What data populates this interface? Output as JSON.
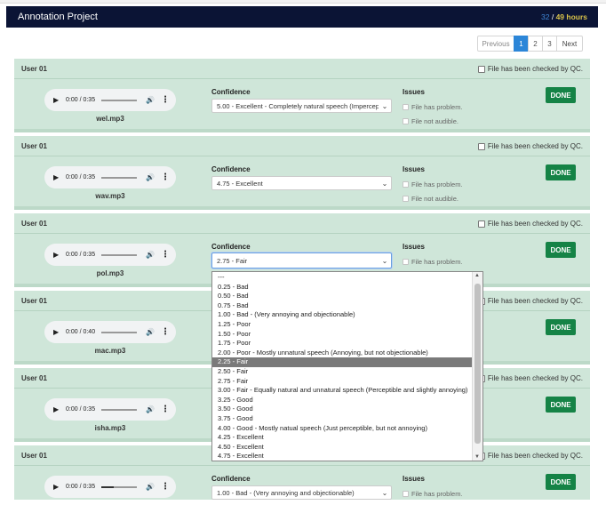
{
  "navbar": {
    "title": "Annotation Project",
    "hours_done": "32",
    "hours_sep": " / ",
    "hours_total": "49 hours"
  },
  "pagination": {
    "previous": "Previous",
    "pages": [
      "1",
      "2",
      "3"
    ],
    "next": "Next",
    "active_page": "1"
  },
  "labels": {
    "confidence": "Confidence",
    "issues": "Issues",
    "qc": "File has been checked by QC.",
    "problem": "File has problem.",
    "not_audible": "File not audible.",
    "done": "DONE"
  },
  "cards": [
    {
      "user": "User 01",
      "time": "0:00 / 0:35",
      "file": "wel.mp3",
      "confidence": "5.00 - Excellent - Completely natural speech (Imperceptible)",
      "progress": 0.0
    },
    {
      "user": "User 01",
      "time": "0:00 / 0:35",
      "file": "wav.mp3",
      "confidence": "4.75 - Excellent",
      "progress": 0.0
    },
    {
      "user": "User 01",
      "time": "0:00 / 0:35",
      "file": "pol.mp3",
      "confidence": "2.75 - Fair",
      "progress": 0.0
    },
    {
      "user": "User 01",
      "time": "0:00 / 0:40",
      "file": "mac.mp3",
      "confidence": "",
      "progress": 0.0
    },
    {
      "user": "User 01",
      "time": "0:00 / 0:35",
      "file": "isha.mp3",
      "confidence": "",
      "progress": 0.0
    },
    {
      "user": "User 01",
      "time": "0:00 / 0:35",
      "file": "",
      "confidence": "1.00 - Bad - (Very annoying and objectionable)",
      "progress": 0.35
    }
  ],
  "dropdown": {
    "selected": "2.25 - Fair",
    "options": [
      "---",
      "0.25 - Bad",
      "0.50 - Bad",
      "0.75 - Bad",
      "1.00 - Bad - (Very annoying and objectionable)",
      "1.25 - Poor",
      "1.50 - Poor",
      "1.75 - Poor",
      "2.00 - Poor - Mostly unnatural speech (Annoying, but not objectionable)",
      "2.25 - Fair",
      "2.50 - Fair",
      "2.75 - Fair",
      "3.00 - Fair - Equally natural and unnatural speech (Perceptible and slightly annoying)",
      "3.25 - Good",
      "3.50 - Good",
      "3.75 - Good",
      "4.00 - Good - Mostly natual speech (Just perceptible, but not annoying)",
      "4.25 - Excellent",
      "4.50 - Excellent",
      "4.75 - Excellent"
    ]
  },
  "icons": {
    "play": "play-icon",
    "volume": "volume-icon",
    "more": "more-options-icon",
    "caret": "chevron-down-icon"
  },
  "colors": {
    "navbar_bg": "#0b1435",
    "card_bg": "#cfe6d9",
    "done_button": "#158346",
    "active_page": "#2c86d8",
    "hours_total": "#d9c34a"
  }
}
